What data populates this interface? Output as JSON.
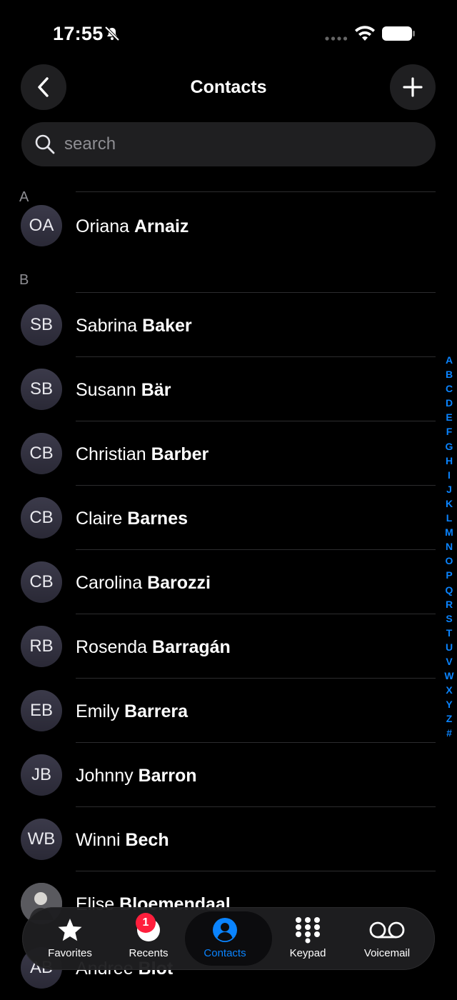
{
  "status_bar": {
    "time": "17:55"
  },
  "header": {
    "title": "Contacts"
  },
  "search": {
    "placeholder": "search"
  },
  "sections": [
    {
      "letter": "A",
      "contacts": [
        {
          "initials": "OA",
          "first": "Oriana",
          "last": "Arnaiz"
        }
      ]
    },
    {
      "letter": "B",
      "contacts": [
        {
          "initials": "SB",
          "first": "Sabrina",
          "last": "Baker"
        },
        {
          "initials": "SB",
          "first": "Susann",
          "last": "Bär"
        },
        {
          "initials": "CB",
          "first": "Christian",
          "last": "Barber"
        },
        {
          "initials": "CB",
          "first": "Claire",
          "last": "Barnes"
        },
        {
          "initials": "CB",
          "first": "Carolina",
          "last": "Barozzi"
        },
        {
          "initials": "RB",
          "first": "Rosenda",
          "last": "Barragán"
        },
        {
          "initials": "EB",
          "first": "Emily",
          "last": "Barrera"
        },
        {
          "initials": "JB",
          "first": "Johnny",
          "last": "Barron"
        },
        {
          "initials": "WB",
          "first": "Winni",
          "last": "Bech"
        },
        {
          "initials": "",
          "first": "Elise",
          "last": "Bloemendaal"
        },
        {
          "initials": "AB",
          "first": "Andree",
          "last": "Blot"
        }
      ]
    }
  ],
  "index_letters": [
    "A",
    "B",
    "C",
    "D",
    "E",
    "F",
    "G",
    "H",
    "I",
    "J",
    "K",
    "L",
    "M",
    "N",
    "O",
    "P",
    "Q",
    "R",
    "S",
    "T",
    "U",
    "V",
    "W",
    "X",
    "Y",
    "Z",
    "#"
  ],
  "tab_bar": {
    "tabs": [
      {
        "label": "Favorites",
        "icon": "star-icon"
      },
      {
        "label": "Recents",
        "icon": "clock-icon",
        "badge": "1"
      },
      {
        "label": "Contacts",
        "icon": "person-circle-icon",
        "active": true
      },
      {
        "label": "Keypad",
        "icon": "keypad-icon"
      },
      {
        "label": "Voicemail",
        "icon": "voicemail-icon"
      }
    ]
  },
  "colors": {
    "accent": "#0a84ff",
    "badge": "#ff1e3c",
    "background": "#000000"
  }
}
